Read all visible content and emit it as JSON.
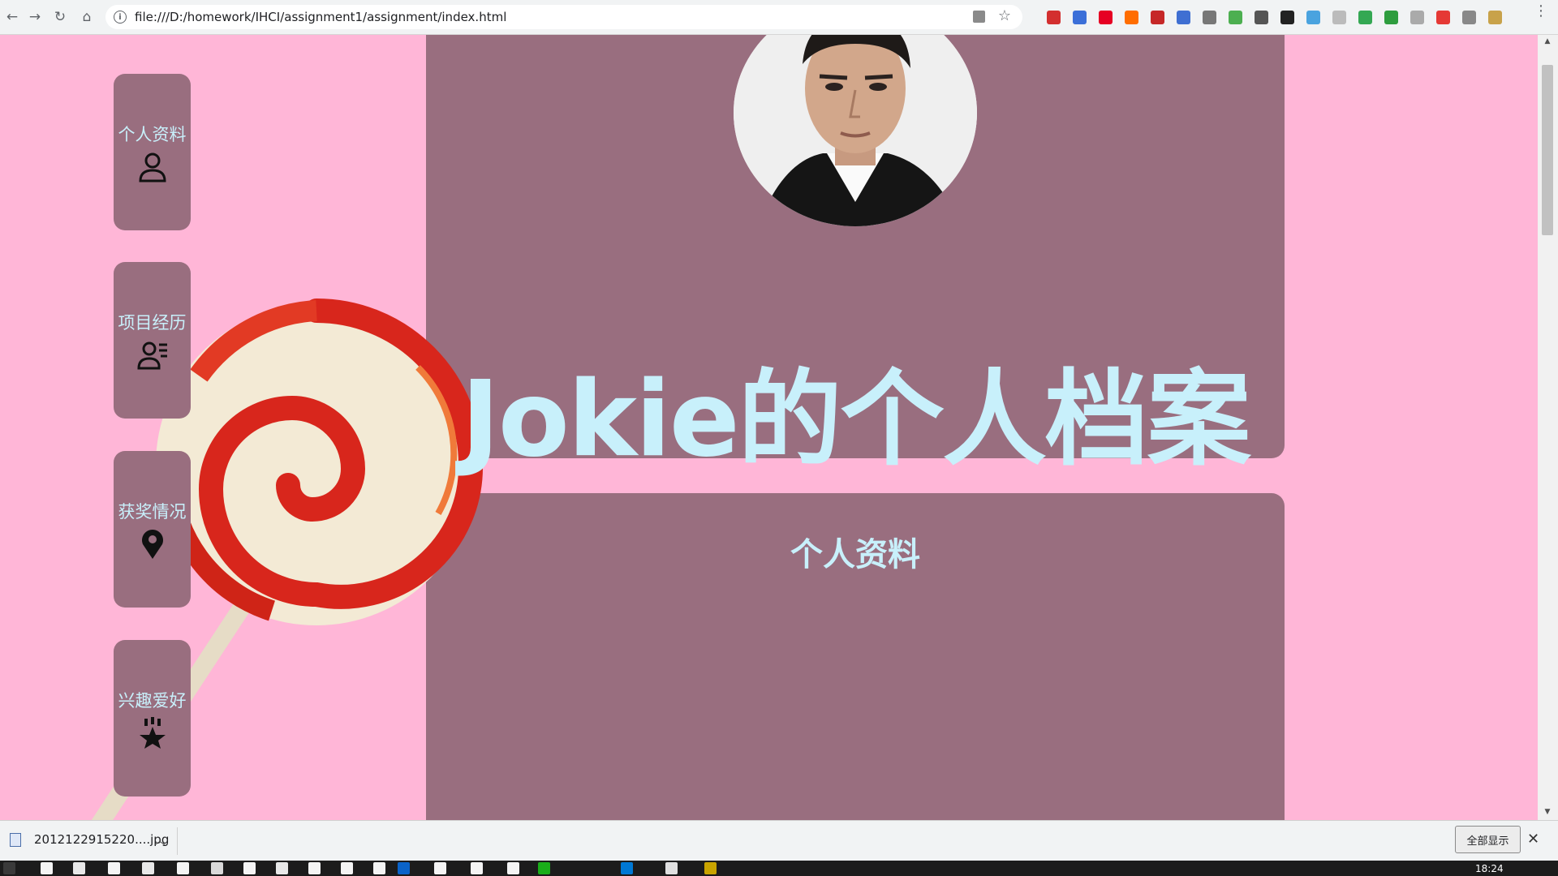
{
  "browser": {
    "url": "file:///D:/homework/IHCI/assignment1/assignment/index.html",
    "extension_icons": [
      "ext-red-icon",
      "ext-new-icon",
      "pinterest-icon",
      "ext-orange-icon",
      "adblock-icon",
      "ext-blue-icon",
      "ext-gray-icon",
      "ext-color-icon",
      "bookmark-icon",
      "bookmark-dark-icon",
      "ext-cloud-icon",
      "ext-camera-icon",
      "ext-green-icon",
      "evernote-icon",
      "ext-shield-icon",
      "ext-red2-icon",
      "ext-v-icon",
      "ext-folder-icon"
    ]
  },
  "sidebar": {
    "items": [
      {
        "label": "个人资料",
        "icon": "person-icon"
      },
      {
        "label": "项目经历",
        "icon": "person-list-icon"
      },
      {
        "label": "获奖情况",
        "icon": "map-pin-icon"
      },
      {
        "label": "兴趣爱好",
        "icon": "paw-icon"
      }
    ]
  },
  "main": {
    "title": "Jokie的个人档案",
    "section_title": "个人资料"
  },
  "download_bar": {
    "file_name": "2012122915220....jpg",
    "show_all_label": "全部显示"
  },
  "taskbar": {
    "time": "18:24"
  },
  "colors": {
    "page_bg": "#ffb6d7",
    "card_bg": "#996e7f",
    "text_accent": "#c8f0fb"
  }
}
